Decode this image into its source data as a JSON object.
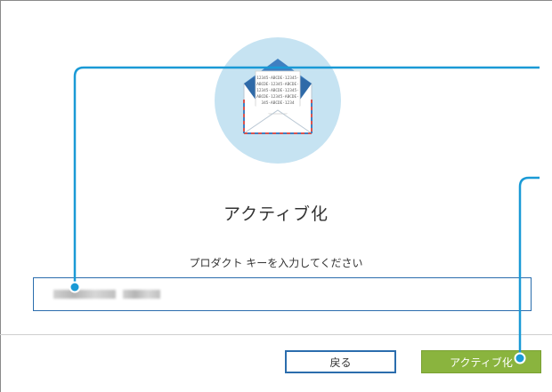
{
  "dialog": {
    "title": "アクティブ化",
    "subtitle": "プロダクト キーを入力してください"
  },
  "product_key": {
    "value": "",
    "obscured": true
  },
  "buttons": {
    "back_label": "戻る",
    "activate_label": "アクティブ化"
  },
  "envelope_card_lines": [
    "12345-ABCDE-12345-",
    "ABCDE-12345-ABCDE-",
    "12345-ABCDE-12345-",
    "ABCDE-12345-ABCDE-",
    "345-ABCDE-1234"
  ],
  "colors": {
    "accent_blue": "#2b6dad",
    "callout_cyan": "#1a9ad6",
    "activate_green": "#8ab43e",
    "hero_circle": "#c6e3f2"
  }
}
